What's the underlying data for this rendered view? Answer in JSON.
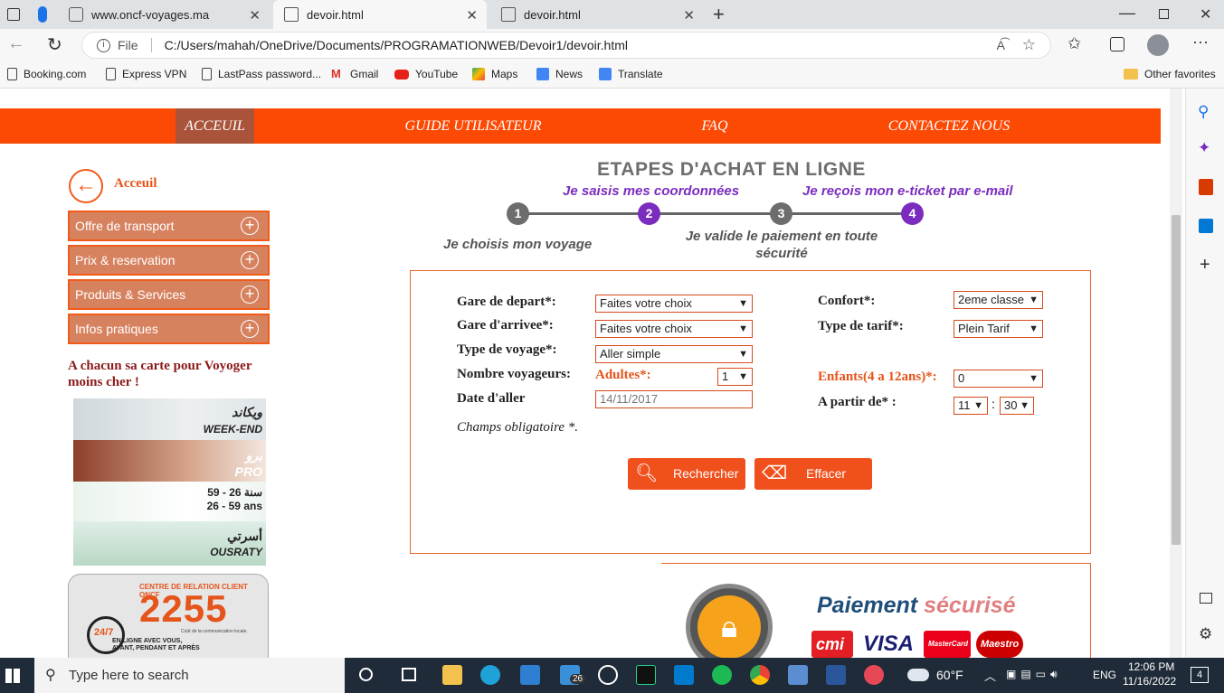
{
  "browser": {
    "tabs": [
      {
        "title": "www.oncf-voyages.ma",
        "active": false
      },
      {
        "title": "devoir.html",
        "active": true
      },
      {
        "title": "devoir.html",
        "active": false
      }
    ],
    "address_label": "File",
    "address": "C:/Users/mahah/OneDrive/Documents/PROGRAMATIONWEB/Devoir1/devoir.html",
    "bookmarks": [
      "Booking.com",
      "Express VPN",
      "LastPass password...",
      "Gmail",
      "YouTube",
      "Maps",
      "News",
      "Translate"
    ],
    "other_favorites": "Other favorites"
  },
  "nav": {
    "items": [
      "ACCEUIL",
      "GUIDE UTILISATEUR",
      "FAQ",
      "CONTACTEZ NOUS"
    ],
    "active_index": 0
  },
  "sidebar": {
    "back_label": "Acceuil",
    "menu": [
      "Offre de transport",
      "Prix & reservation",
      "Produits & Services",
      "Infos pratiques"
    ],
    "promo_text": "A chacun sa carte pour Voyoger moins cher !",
    "promo_cards": [
      {
        "arabic": "ويكاند",
        "label": "WEEK-END"
      },
      {
        "arabic": "برو",
        "label": "PRO"
      },
      {
        "arabic": "59 - 26 سنة",
        "label": "26 - 59 ans"
      },
      {
        "arabic": "أسرتي",
        "label": "OUSRATY"
      }
    ],
    "relation": {
      "header": "CENTRE DE RELATION CLIENT ONCF",
      "number": "2255",
      "cost": "Coût de la communication locale.",
      "badge": "24/7",
      "text": "EN LIGNE AVEC VOUS, AVANT, PENDANT ET APRÈS"
    }
  },
  "steps": {
    "title": "ETAPES D'ACHAT EN LIGNE",
    "items": [
      {
        "n": "1",
        "label": "Je choisis mon voyage"
      },
      {
        "n": "2",
        "label": "Je saisis mes coordonnées"
      },
      {
        "n": "3",
        "label": "Je valide le paiement en toute sécurité"
      },
      {
        "n": "4",
        "label": "Je reçois mon e-ticket par e-mail"
      }
    ]
  },
  "form": {
    "gare_depart": {
      "label": "Gare de depart*:",
      "value": "Faites votre choix"
    },
    "gare_arrivee": {
      "label": "Gare d'arrivee*:",
      "value": "Faites votre choix"
    },
    "type_voyage": {
      "label": "Type de voyage*:",
      "value": "Aller simple"
    },
    "nombre": {
      "label": "Nombre voyageurs:",
      "adultes_label": "Adultes*:",
      "adultes_value": "1"
    },
    "date": {
      "label": "Date d'aller",
      "value": "14/11/2017"
    },
    "confort": {
      "label": "Confort*:",
      "value": "2eme classe"
    },
    "tarif": {
      "label": "Type de tarif*:",
      "value": "Plein Tarif"
    },
    "enfants": {
      "label": "Enfants(4 a 12ans)*:",
      "value": "0"
    },
    "heure": {
      "label": "A partir de* :",
      "hour": "11",
      "sep": ":",
      "minute": "30"
    },
    "required_note": "Champs obligatoire *.",
    "search_button": "Rechercher",
    "clear_button": "Effacer"
  },
  "payment": {
    "title_a": "Paiement",
    "title_b": "sécurisé",
    "cards": [
      "cmi",
      "VISA",
      "MasterCard",
      "Maestro"
    ]
  },
  "taskbar": {
    "search_placeholder": "Type here to search",
    "mail_badge": "26",
    "weather": "60°F",
    "lang": "ENG",
    "time": "12:06 PM",
    "date": "11/16/2022",
    "notif": "4"
  }
}
